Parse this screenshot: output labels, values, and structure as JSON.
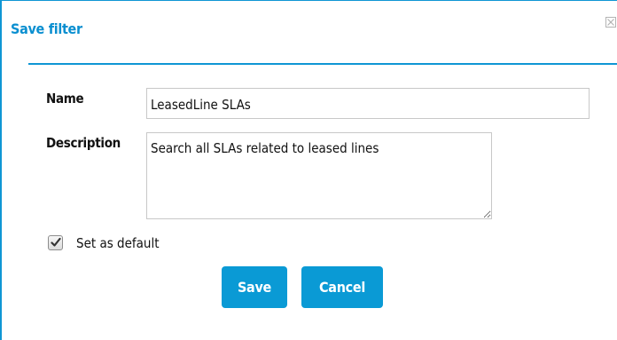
{
  "dialog": {
    "title": "Save filter",
    "close_icon": "close-icon",
    "accent_color": "#0f96d4"
  },
  "form": {
    "name_label": "Name",
    "name_value": "LeasedLine SLAs",
    "description_label": "Description",
    "description_value": "Search all SLAs related to leased lines",
    "set_default_label": "Set as default",
    "set_default_checked": true
  },
  "buttons": {
    "save_label": "Save",
    "cancel_label": "Cancel",
    "button_color": "#0a9ad5"
  }
}
